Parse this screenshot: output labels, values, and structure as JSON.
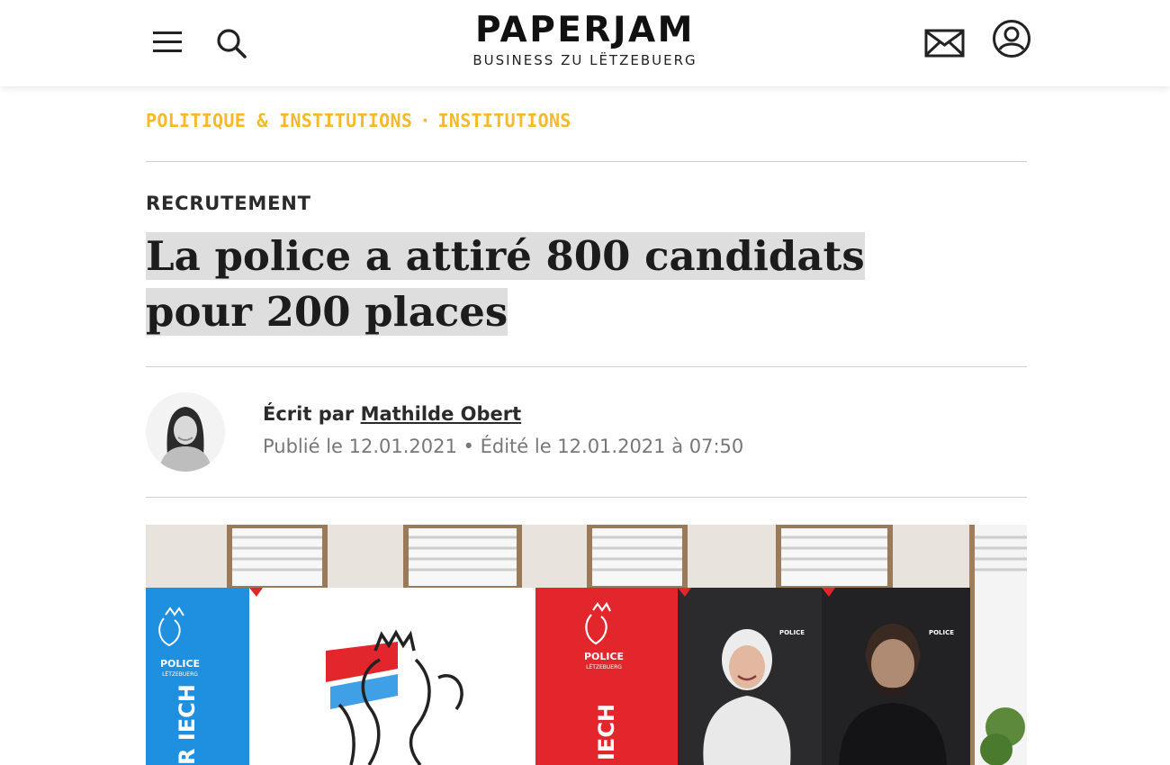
{
  "header": {
    "logo_title": "PAPERJAM",
    "logo_subtitle": "BUSINESS ZU LËTZEBUERG",
    "icons": [
      "menu-icon",
      "search-icon",
      "mail-icon",
      "user-icon"
    ]
  },
  "breadcrumb": {
    "section": "POLITIQUE & INSTITUTIONS",
    "separator": "·",
    "subsection": "INSTITUTIONS"
  },
  "article": {
    "kicker": "RECRUTEMENT",
    "title": "La police a attiré 800 candidats pour 200 places",
    "byline_prefix": "Écrit par",
    "author": "Mathilde Obert",
    "dates": "Publié le 12.01.2021 • Édité le 12.01.2021 à 07:50"
  },
  "hero": {
    "panel_label": "POLICE",
    "panel_sublabel": "LËTZEBUERG",
    "vertical_text_1": "R IECH",
    "vertical_text_2": "IECH"
  },
  "colors": {
    "accent": "#f5b82e",
    "police_blue": "#1f8fe0",
    "police_red": "#e2262b",
    "dark_panel": "#2a2a2c"
  }
}
